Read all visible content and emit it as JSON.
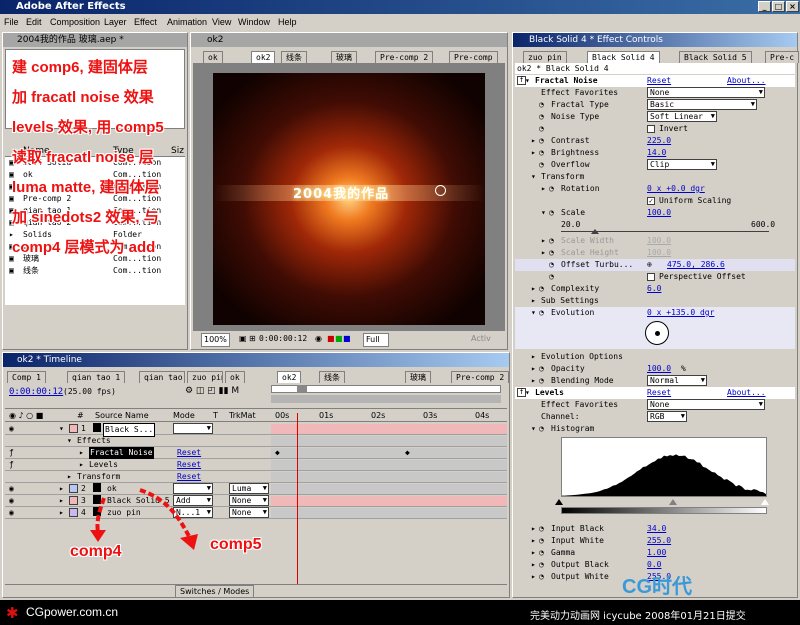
{
  "app": {
    "title": "Adobe After Effects"
  },
  "menu": [
    "File",
    "Edit",
    "Composition",
    "Layer",
    "Effect",
    "Animation",
    "View",
    "Window",
    "Help"
  ],
  "project": {
    "title": "2004我的作品 玻璃.aep *",
    "col_name": "Name",
    "col_type": "Type",
    "col_size": "Siz",
    "items": [
      {
        "name": "2004 Solid",
        "type": "Com...tion"
      },
      {
        "name": "ok",
        "type": "Com...tion"
      },
      {
        "name": "ok2",
        "type": "Com...tion"
      },
      {
        "name": "Pre-comp 2",
        "type": "Com...tion"
      },
      {
        "name": "qian tao 1",
        "type": "Com...tion"
      },
      {
        "name": "qian tao 2",
        "type": "Com...tion"
      },
      {
        "name": "Solids",
        "type": "Folder"
      },
      {
        "name": "zuo pin",
        "type": "Com...tion"
      },
      {
        "name": "玻璃",
        "type": "Com...tion"
      },
      {
        "name": "线条",
        "type": "Com...tion"
      }
    ]
  },
  "annotation": {
    "lines": [
      "建 comp6, 建固体层",
      "加 fracatl noise 效果",
      "levels 效果, 用 comp5",
      "读取 fracatl noise 层",
      "luma matte, 建固体层",
      "加 sinedots2 效果, 与",
      "comp4 层模式为 add"
    ],
    "label_comp4": "comp4",
    "label_comp5": "comp5"
  },
  "comp": {
    "title": "ok2",
    "tabs": [
      "ok",
      "ok2",
      "线条",
      "玻璃",
      "Pre-comp 2",
      "Pre-comp"
    ],
    "viewer_text": "2004我的作品",
    "zoom": "100%",
    "time": "0:00:00:12",
    "resolution": "Full",
    "active_label": "Activ"
  },
  "effects": {
    "title": "Black Solid 4 * Effect Controls",
    "tabs": [
      "zuo pin",
      "Black Solid 4",
      "Black Solid 5",
      "Pre-c"
    ],
    "header": "ok2 * Black Solid 4",
    "fractal": {
      "name": "Fractal Noise",
      "reset": "Reset",
      "about": "About...",
      "favorites_label": "Effect Favorites",
      "favorites_value": "None",
      "type_label": "Fractal Type",
      "type_value": "Basic",
      "noise_label": "Noise Type",
      "noise_value": "Soft Linear",
      "invert_label": "Invert",
      "contrast_label": "Contrast",
      "contrast_value": "225.0",
      "brightness_label": "Brightness",
      "brightness_value": "14.0",
      "overflow_label": "Overflow",
      "overflow_value": "Clip",
      "transform_label": "Transform",
      "rotation_label": "Rotation",
      "rotation_value": "0 x +0.0 dgr",
      "uniform_label": "Uniform Scaling",
      "scale_label": "Scale",
      "scale_value": "100.0",
      "scale_min": "20.0",
      "scale_max": "600.0",
      "scale_width_label": "Scale Width",
      "scale_width_value": "100.0",
      "scale_height_label": "Scale Height",
      "scale_height_value": "100.0",
      "offset_label": "Offset Turbu...",
      "offset_value": "475.0, 286.6",
      "perspective_label": "Perspective Offset",
      "complexity_label": "Complexity",
      "complexity_value": "6.0",
      "sub_label": "Sub Settings",
      "evolution_label": "Evolution",
      "evolution_value": "0 x +135.0 dgr",
      "evo_options_label": "Evolution Options",
      "opacity_label": "Opacity",
      "opacity_value": "100.0",
      "opacity_unit": "%",
      "blending_label": "Blending Mode",
      "blending_value": "Normal"
    },
    "levels": {
      "name": "Levels",
      "reset": "Reset",
      "about": "About...",
      "favorites_label": "Effect Favorites",
      "favorites_value": "None",
      "channel_label": "Channel:",
      "channel_value": "RGB",
      "histogram_label": "Histogram",
      "input_black_label": "Input Black",
      "input_black_value": "34.0",
      "input_white_label": "Input White",
      "input_white_value": "255.0",
      "gamma_label": "Gamma",
      "gamma_value": "1.00",
      "output_black_label": "Output Black",
      "output_black_value": "0.0",
      "output_white_label": "Output White",
      "output_white_value": "255.0"
    }
  },
  "timeline": {
    "title": "ok2 * Timeline",
    "tabs": [
      "Comp 1",
      "qian tao 1",
      "qian tao 2",
      "zuo pin",
      "ok",
      "ok2",
      "线条",
      "玻璃",
      "Pre-comp 2"
    ],
    "time": "0:00:00:12",
    "fps": "(25.00 fps)",
    "col_num": "#",
    "col_source": "Source Name",
    "col_mode": "Mode",
    "col_t": "T",
    "col_trkmat": "TrkMat",
    "ruler": [
      "00s",
      "01s",
      "02s",
      "03s",
      "04s"
    ],
    "layers": [
      {
        "num": "1",
        "name": "Black S...",
        "mode": "",
        "trkmat": ""
      },
      {
        "num": "2",
        "name": "ok",
        "mode": "",
        "trkmat": "Luma"
      },
      {
        "num": "3",
        "name": "Black Solid 5",
        "mode": "Add",
        "trkmat": "None"
      },
      {
        "num": "4",
        "name": "zuo pin",
        "mode": "N...1",
        "trkmat": "None"
      }
    ],
    "effects_label": "Effects",
    "fractal_label": "Fractal Noise",
    "levels_label": "Levels",
    "transform_label": "Transform",
    "reset": "Reset",
    "switches_label": "Switches / Modes"
  },
  "footer": {
    "left_logo": "CGpower.com.cn",
    "right_text": "完美动力动画网 icycube 2008年01月21日提交",
    "cg_logo": "CG时代"
  },
  "colors": {
    "accent": "#0a246a",
    "link": "#0000cc",
    "annotation": "#ee1111",
    "layer_pink": "#f0b8b8"
  }
}
